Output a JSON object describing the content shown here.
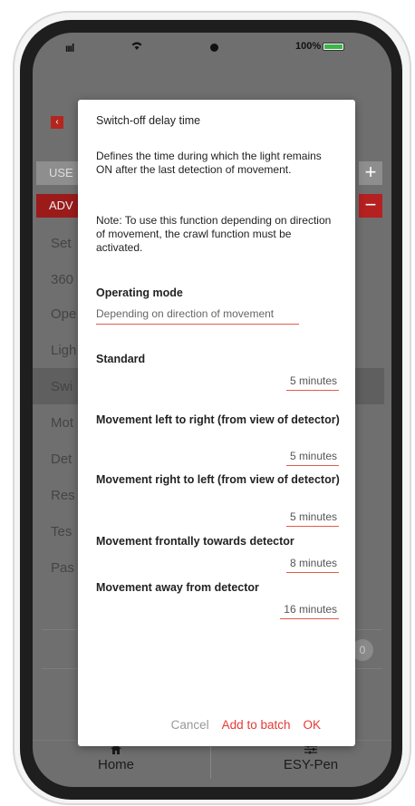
{
  "status_bar": {
    "signal": "ıııl",
    "battery": "100%"
  },
  "background": {
    "sections": [
      "USE",
      "ADV"
    ],
    "items": [
      "Set",
      "360",
      "Ope",
      "Ligh",
      "Swi",
      "Mot",
      "Det",
      "Res",
      "Tes",
      "Pas"
    ],
    "toggle": "0",
    "tabs": {
      "home": "Home",
      "esy": "ESY-Pen"
    }
  },
  "dialog": {
    "title": "Switch-off delay time",
    "description": "Defines the time during which the light remains ON after the last detection of movement.",
    "note": "Note: To use this function depending on direction of movement, the crawl function must be activated.",
    "operating_mode_label": "Operating mode",
    "operating_mode_value": "Depending on direction of movement",
    "settings": [
      {
        "label": "Standard",
        "value": "5 minutes"
      },
      {
        "label": "Movement left to right (from view of detector)",
        "value": "5 minutes"
      },
      {
        "label": "Movement right to left (from view of detector)",
        "value": "5 minutes"
      },
      {
        "label": "Movement frontally towards detector",
        "value": "8 minutes"
      },
      {
        "label": "Movement away from detector",
        "value": "16 minutes"
      }
    ],
    "actions": {
      "cancel": "Cancel",
      "add_to_batch": "Add to batch",
      "ok": "OK"
    }
  },
  "colors": {
    "accent": "#e53935",
    "underline": "#e25b4a",
    "overlay": "#6f6f6f"
  }
}
